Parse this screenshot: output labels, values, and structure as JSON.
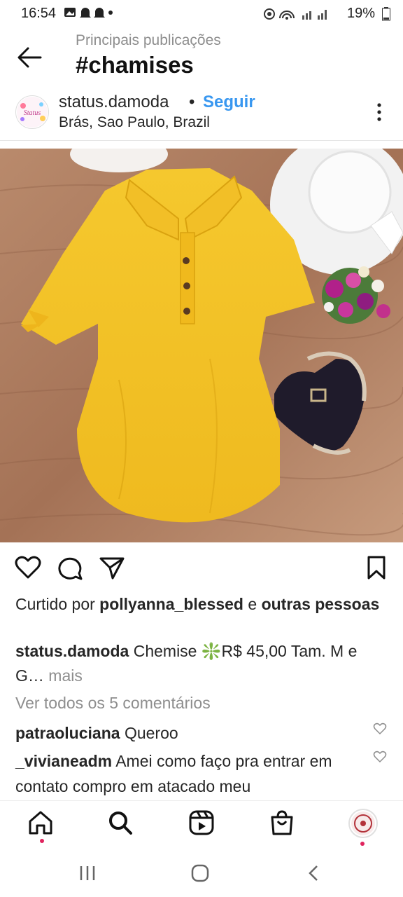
{
  "status_bar": {
    "time": "16:54",
    "battery": "19%"
  },
  "header": {
    "subtitle": "Principais publicações",
    "title": "#chamises"
  },
  "post": {
    "username": "status.damoda",
    "separator": "•",
    "follow_label": "Seguir",
    "location": "Brás, Sao Paulo, Brazil",
    "avatar_text": "Status",
    "liked_prefix": "Curtido por",
    "liked_user": "pollyanna_blessed",
    "liked_and": "e",
    "liked_others": "outras pessoas",
    "caption_user": "status.damoda",
    "caption_text": "Chemise ❇️R$ 45,00 Tam. M e G…",
    "caption_more": "mais",
    "view_all": "Ver todos os 5 comentários",
    "comments": [
      {
        "user": "patraoluciana",
        "text": "Queroo"
      },
      {
        "user": "_vivianeadm",
        "text": "Amei como faço pra entrar em contato compro em atacado meu"
      }
    ]
  },
  "icons": {
    "back": "arrow-left-icon",
    "more": "more-vertical-icon",
    "like": "heart-icon",
    "comment": "comment-icon",
    "share": "send-icon",
    "save": "bookmark-icon",
    "nav": [
      "home-icon",
      "search-icon",
      "reels-icon",
      "shop-icon",
      "profile-avatar"
    ]
  },
  "colors": {
    "link": "#3897f0",
    "muted": "#8e8e8e",
    "text": "#262626",
    "notification_dot": "#e0245e"
  }
}
